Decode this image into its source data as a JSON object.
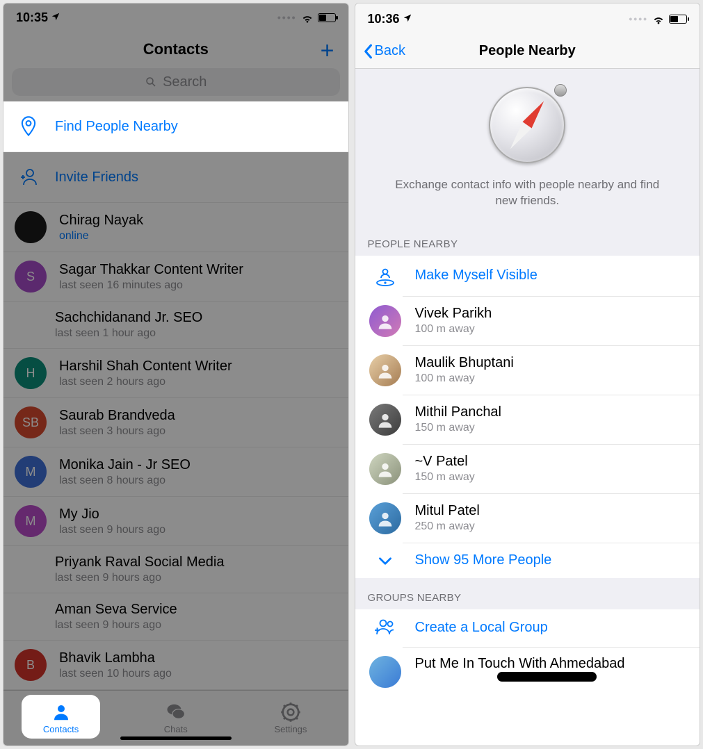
{
  "left": {
    "status": {
      "time": "10:35"
    },
    "header": {
      "title": "Contacts"
    },
    "search": {
      "placeholder": "Search"
    },
    "actions": {
      "find_nearby": "Find People Nearby",
      "invite_friends": "Invite Friends"
    },
    "contacts": [
      {
        "name": "Chirag Nayak",
        "status": "online",
        "avatarBg": "#1b1b1b",
        "initials": ""
      },
      {
        "name": "Sagar Thakkar Content Writer",
        "status": "last seen 16 minutes ago",
        "avatarBg": "#a64cc9",
        "initials": "S"
      },
      {
        "name": "Sachchidanand Jr. SEO",
        "status": "last seen 1 hour ago",
        "avatarBg": "",
        "initials": ""
      },
      {
        "name": "Harshil Shah Content Writer",
        "status": "last seen 2 hours ago",
        "avatarBg": "#0b8f7a",
        "initials": "H"
      },
      {
        "name": "Saurab Brandveda",
        "status": "last seen 3 hours ago",
        "avatarBg": "#d84a2f",
        "initials": "SB"
      },
      {
        "name": "Monika Jain - Jr SEO",
        "status": "last seen 8 hours ago",
        "avatarBg": "#3f6fd8",
        "initials": "M"
      },
      {
        "name": "My Jio",
        "status": "last seen 9 hours ago",
        "avatarBg": "#b94cc9",
        "initials": "M"
      },
      {
        "name": "Priyank Raval Social Media",
        "status": "last seen 9 hours ago",
        "avatarBg": "",
        "initials": ""
      },
      {
        "name": "Aman Seva Service",
        "status": "last seen 9 hours ago",
        "avatarBg": "",
        "initials": ""
      },
      {
        "name": "Bhavik Lambha",
        "status": "last seen 10 hours ago",
        "avatarBg": "#d4342b",
        "initials": "B"
      }
    ],
    "tabs": {
      "contacts": "Contacts",
      "chats": "Chats",
      "settings": "Settings"
    }
  },
  "right": {
    "status": {
      "time": "10:36"
    },
    "nav": {
      "back": "Back",
      "title": "People Nearby"
    },
    "hero": {
      "text": "Exchange contact info with people nearby and find new friends."
    },
    "sections": {
      "people_header": "PEOPLE NEARBY",
      "make_visible": "Make Myself Visible",
      "people": [
        {
          "name": "Vivek Parikh",
          "distance": "100 m away"
        },
        {
          "name": "Maulik Bhuptani",
          "distance": "100 m away"
        },
        {
          "name": "Mithil Panchal",
          "distance": "150 m away"
        },
        {
          "name": "~V Patel",
          "distance": "150 m away"
        },
        {
          "name": "Mitul Patel",
          "distance": "250 m away"
        }
      ],
      "show_more": "Show 95 More People",
      "groups_header": "GROUPS NEARBY",
      "create_group": "Create a Local Group",
      "partial_group": "Put Me In Touch With Ahmedabad"
    }
  }
}
